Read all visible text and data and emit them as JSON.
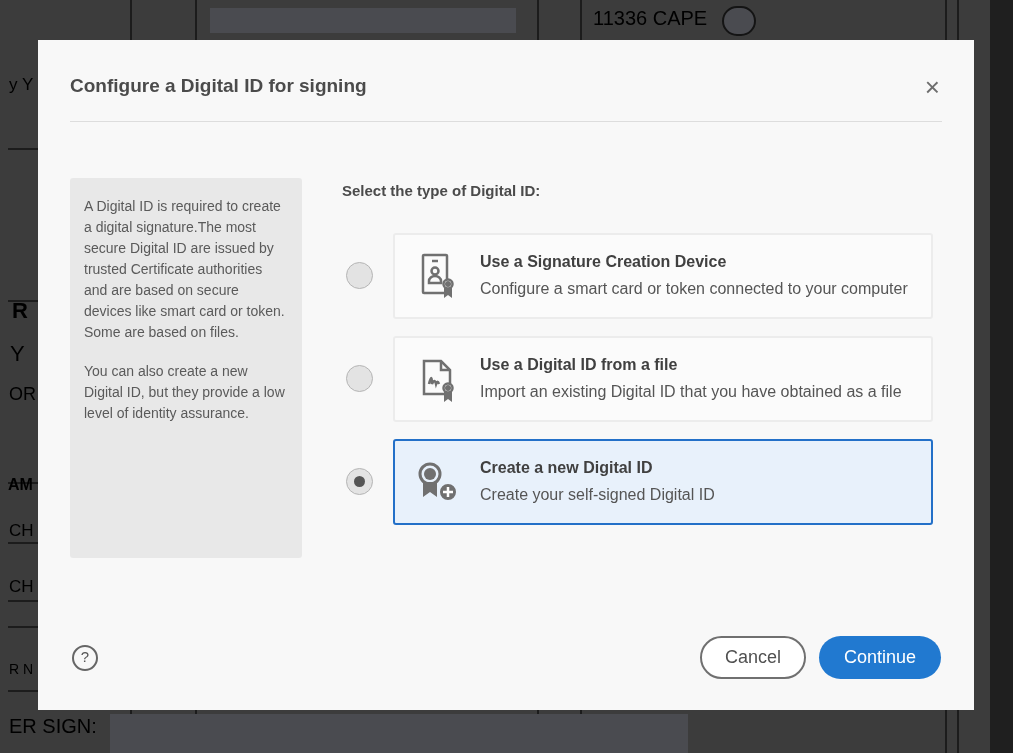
{
  "background_fragments": [
    "11336 CAPE",
    "y Y",
    "R",
    "Y",
    "OR",
    "AM",
    "CH",
    "CH",
    "R N",
    "ER SIGN:"
  ],
  "dialog": {
    "title": "Configure a Digital ID for signing",
    "close": "×",
    "info": [
      "A Digital ID is required to create a digital signature.The most secure Digital ID are issued by trusted Certificate authorities and are based on secure devices like smart card or token. Some are based on files.",
      "You can also create a new Digital ID, but they provide a low level of identity assurance."
    ],
    "prompt": "Select the type of Digital ID:",
    "options": [
      {
        "kind": "device",
        "title": "Use a Signature Creation Device",
        "description": "Configure a smart card or token connected to your computer",
        "selected": false
      },
      {
        "kind": "file",
        "title": "Use a Digital ID from a file",
        "description": "Import an existing Digital ID that you have obtained as a file",
        "selected": false
      },
      {
        "kind": "new",
        "title": "Create a new Digital ID",
        "description": "Create your self-signed Digital ID",
        "selected": true
      }
    ],
    "help": "?",
    "buttons": {
      "cancel": "Cancel",
      "continue": "Continue"
    }
  }
}
